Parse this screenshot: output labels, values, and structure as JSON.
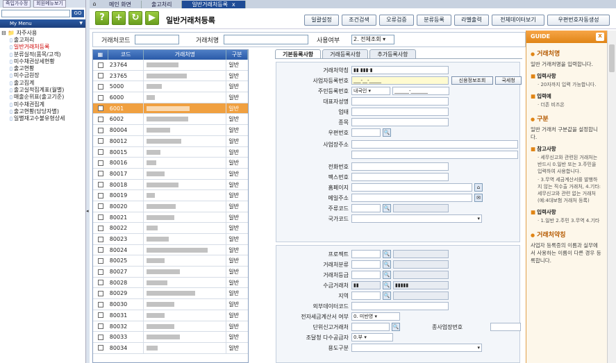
{
  "left": {
    "top_links": [
      "즉입가수정",
      "회원메뉴보기"
    ],
    "go_label": "GO",
    "menu_title": "My Menu",
    "group": "자주사용",
    "items": [
      {
        "label": "출고처리",
        "active": false
      },
      {
        "label": "일반거래처등록",
        "active": true
      },
      {
        "label": "분류실적(품목/고객)",
        "active": false
      },
      {
        "label": "미수채권상세현황",
        "active": false
      },
      {
        "label": "출고현황",
        "active": false
      },
      {
        "label": "미수금원장",
        "active": false
      },
      {
        "label": "출고집계",
        "active": false
      },
      {
        "label": "출고실적집계표(월별)",
        "active": false
      },
      {
        "label": "매출순위표(출고기준)",
        "active": false
      },
      {
        "label": "미수채권집계",
        "active": false
      },
      {
        "label": "출고현황(담당자별)",
        "active": false
      },
      {
        "label": "일별재고수불유형상세",
        "active": false
      }
    ]
  },
  "tabs": {
    "items": [
      "메인 화면",
      "출고처리",
      "일반거래처등록"
    ],
    "active": 2,
    "close": "x"
  },
  "toolbar": {
    "icons": [
      "?",
      "+",
      "↻",
      "▶"
    ],
    "title": "일반거래처등록",
    "buttons": [
      "일괄설정",
      "조건검색",
      "오류검증",
      "분류등록",
      "라벨출력",
      "전체데이터보기",
      "우편번호자동생성"
    ]
  },
  "filter": {
    "code_label": "거래처코드",
    "name_label": "거래처명",
    "use_label": "사용여부",
    "use_value": "2. 전체조회"
  },
  "grid": {
    "headers": [
      "코드",
      "거래처명",
      "구분"
    ],
    "rows": [
      {
        "code": "23764",
        "type": "일반",
        "w": 46
      },
      {
        "code": "23765",
        "type": "일반",
        "w": 58
      },
      {
        "code": "5000",
        "type": "일반",
        "w": 22
      },
      {
        "code": "6000",
        "type": "일반",
        "w": 12
      },
      {
        "code": "6001",
        "type": "일반",
        "w": 62,
        "sel": true
      },
      {
        "code": "6002",
        "type": "일반",
        "w": 60
      },
      {
        "code": "80004",
        "type": "일반",
        "w": 34
      },
      {
        "code": "80012",
        "type": "일반",
        "w": 50
      },
      {
        "code": "80015",
        "type": "일반",
        "w": 20
      },
      {
        "code": "80016",
        "type": "일반",
        "w": 14
      },
      {
        "code": "80017",
        "type": "일반",
        "w": 26
      },
      {
        "code": "80018",
        "type": "일반",
        "w": 46
      },
      {
        "code": "80019",
        "type": "일반",
        "w": 12
      },
      {
        "code": "80020",
        "type": "일반",
        "w": 42
      },
      {
        "code": "80021",
        "type": "일반",
        "w": 40
      },
      {
        "code": "80022",
        "type": "일반",
        "w": 16
      },
      {
        "code": "80023",
        "type": "일반",
        "w": 32
      },
      {
        "code": "80024",
        "type": "일반",
        "w": 88
      },
      {
        "code": "80025",
        "type": "일반",
        "w": 26
      },
      {
        "code": "80027",
        "type": "일반",
        "w": 48
      },
      {
        "code": "80028",
        "type": "일반",
        "w": 30
      },
      {
        "code": "80029",
        "type": "일반",
        "w": 70
      },
      {
        "code": "80030",
        "type": "일반",
        "w": 40
      },
      {
        "code": "80031",
        "type": "일반",
        "w": 26
      },
      {
        "code": "80032",
        "type": "일반",
        "w": 40
      },
      {
        "code": "80033",
        "type": "일반",
        "w": 48
      },
      {
        "code": "80034",
        "type": "일반",
        "w": 16
      }
    ]
  },
  "form": {
    "tabs": [
      "기본등록사항",
      "거래등록사항",
      "추가등록사항"
    ],
    "fields": {
      "short_name": "거래처약칭",
      "biz_no": "사업자등록번호",
      "biz_no_value": "___-__-_____",
      "credit_btn": "신용정보조회",
      "tax_btn": "국세청",
      "resident_no": "주민등록번호",
      "nation": "내국인",
      "resident_value": "______-_______",
      "ceo": "대표자성명",
      "biz_type": "업태",
      "item": "종목",
      "zip": "우편번호",
      "address": "사업장주소",
      "phone": "전화번호",
      "fax": "팩스번호",
      "homepage": "홈페이지",
      "email": "메일주소",
      "main_code": "주류코드",
      "country": "국가코드",
      "project": "프로젝트",
      "cls": "거래처분류",
      "grade": "거래처등급",
      "collect": "수금거래처",
      "region": "지역",
      "ext_code": "외부데이터코드",
      "etax": "전자세금계산서 여부",
      "etax_value": "0. 미반영",
      "unit_report": "단위신고거래처",
      "sub_biz_no": "종사업장번호",
      "multi_supplier": "조달청 다수공급자",
      "multi_value": "0.부",
      "usage": "용도구분"
    }
  },
  "guide": {
    "title": "GUIDE",
    "close": "x",
    "sections": [
      {
        "head": "거래처명",
        "desc": "일반 거래처명을 입력합니다.",
        "subs": [
          {
            "title": "입력사항",
            "lines": [
              "· 20자까지 입력 가능합니다."
            ]
          },
          {
            "title": "입력예",
            "lines": [
              "· 더존 비즈온"
            ]
          }
        ]
      },
      {
        "head": "구분",
        "desc": "일반 거래처 구분값을 설정합니다.",
        "subs": [
          {
            "title": "참고사항",
            "lines": [
              "· 세무신고와 관련된 거래처는 반드시 0.일반 또는 3.주민을 입력하여 사용합니다.",
              "· 3.무역 세금계산서를 발행하지 않는 직수출 거래처, 4.기타: 세무신고와 관련 없는 거래처(예:4대보험 거래처 등록)"
            ]
          },
          {
            "title": "입력사항",
            "lines": [
              "· 1.일반 2.주민 3.무역 4.기타"
            ]
          }
        ]
      },
      {
        "head": "거래처약칭",
        "desc": "사업자 등록증의 이름과 실무에서 사용하는 이름이 다른 경우 등록합니다.",
        "subs": []
      }
    ]
  }
}
